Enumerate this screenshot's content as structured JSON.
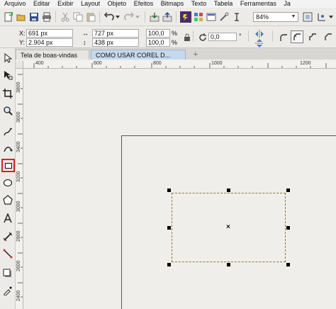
{
  "menu": [
    "Arquivo",
    "Editar",
    "Exibir",
    "Layout",
    "Objeto",
    "Efeitos",
    "Bitmaps",
    "Texto",
    "Tabela",
    "Ferramentas",
    "Ja"
  ],
  "toolbar": {
    "zoom_value": "84%"
  },
  "properties": {
    "x_label": "X:",
    "x_value": "691 px",
    "y_label": "Y:",
    "y_value": "2.904 px",
    "width_value": "727 px",
    "height_value": "438 px",
    "scale_w": "100,0",
    "scale_h": "100,0",
    "percent": "%",
    "rotation": "0,0",
    "degree": "°"
  },
  "tabs": [
    {
      "label": "Tela de boas-vindas"
    },
    {
      "label": "COMO USAR COREL D..."
    }
  ],
  "tab_add": "+",
  "ruler_h": [
    "400",
    "600",
    "800",
    "1000",
    "1200"
  ],
  "ruler_v": [
    "3800",
    "3600",
    "3400",
    "3200",
    "3000",
    "2800",
    "2600",
    "2400"
  ],
  "center_mark": "×",
  "colors": {
    "accent_red": "#d2232a",
    "active_tab": "#c6d8ee",
    "canvas": "#efeeeb"
  }
}
